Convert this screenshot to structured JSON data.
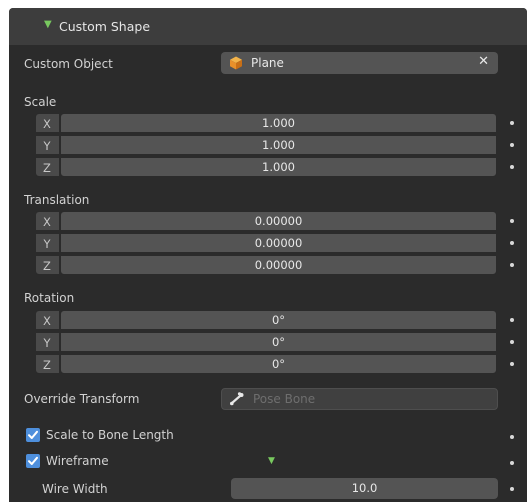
{
  "panel": {
    "title": "Custom Shape"
  },
  "custom_object": {
    "label": "Custom Object",
    "value": "Plane"
  },
  "scale": {
    "label": "Scale",
    "rows": [
      {
        "axis": "X",
        "value": "1.000"
      },
      {
        "axis": "Y",
        "value": "1.000"
      },
      {
        "axis": "Z",
        "value": "1.000"
      }
    ]
  },
  "translation": {
    "label": "Translation",
    "rows": [
      {
        "axis": "X",
        "value": "0.00000"
      },
      {
        "axis": "Y",
        "value": "0.00000"
      },
      {
        "axis": "Z",
        "value": "0.00000"
      }
    ]
  },
  "rotation": {
    "label": "Rotation",
    "rows": [
      {
        "axis": "X",
        "value": "0°"
      },
      {
        "axis": "Y",
        "value": "0°"
      },
      {
        "axis": "Z",
        "value": "0°"
      }
    ]
  },
  "override_transform": {
    "label": "Override Transform",
    "placeholder": "Pose Bone"
  },
  "scale_to_bone_length": {
    "label": "Scale to Bone Length",
    "checked": true
  },
  "wireframe": {
    "label": "Wireframe",
    "checked": true
  },
  "wire_width": {
    "label": "Wire Width",
    "value": "10.0"
  },
  "colors": {
    "accent": "#4e8fdc",
    "expand": "#78c95f",
    "object": "#e8902a"
  },
  "icons": {
    "collapse": "triangle-down-icon",
    "object": "object-cube-icon",
    "clear": "close-icon",
    "bone": "bone-icon",
    "keyframe": "dot-icon"
  }
}
